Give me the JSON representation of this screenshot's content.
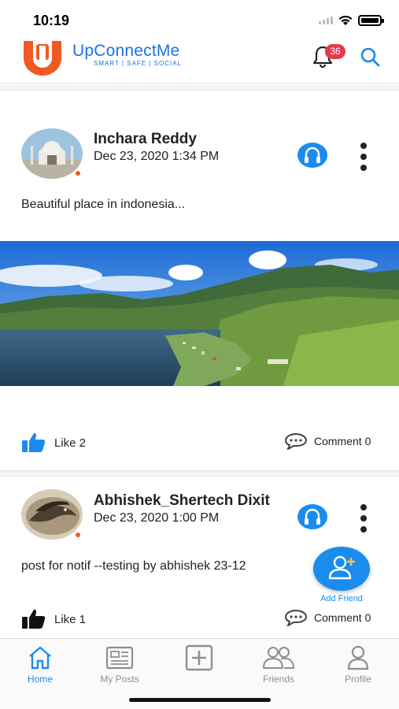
{
  "status_bar": {
    "time": "10:19"
  },
  "header": {
    "brand_name": "UpConnectMe",
    "tagline": "SMART | SAFE | SOCIAL",
    "notification_count": "36",
    "icons": [
      "bell-icon",
      "search-icon"
    ]
  },
  "colors": {
    "brand_blue": "#1a73e8",
    "brand_orange": "#f05a22",
    "accent_blue": "#1a8cf0",
    "badge_red": "#e53950"
  },
  "posts": [
    {
      "author": "Inchara Reddy",
      "date": "Dec 23, 2020 1:34 PM",
      "text": "Beautiful place in indonesia...",
      "like_label": "Like 2",
      "comment_label": "Comment 0",
      "liked": true
    },
    {
      "author": "Abhishek_Shertech Dixit",
      "date": "Dec 23, 2020 1:00 PM",
      "text": "post for notif --testing by abhishek 23-12",
      "like_label": "Like 1",
      "comment_label": "Comment 0",
      "liked": false
    }
  ],
  "fab": {
    "label": "Add Friend"
  },
  "bottom_nav": [
    {
      "label": "Home",
      "icon": "home-icon",
      "active": true
    },
    {
      "label": "My Posts",
      "icon": "posts-icon",
      "active": false
    },
    {
      "label": "",
      "icon": "add-post-icon",
      "active": false
    },
    {
      "label": "Friends",
      "icon": "friends-icon",
      "active": false
    },
    {
      "label": "Profile",
      "icon": "profile-icon",
      "active": false
    }
  ]
}
